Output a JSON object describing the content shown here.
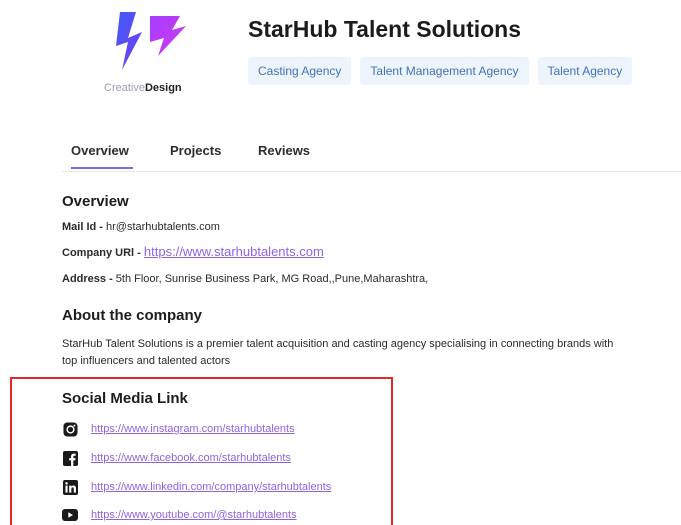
{
  "logo": {
    "text_light": "Creative",
    "text_bold": "Design",
    "accent_colors": [
      "#7a3cf5",
      "#c23bff",
      "#3d5cf5"
    ]
  },
  "company": {
    "name": "StarHub Talent Solutions",
    "tags": [
      "Casting Agency",
      "Talent Management Agency",
      "Talent Agency"
    ]
  },
  "tabs": [
    {
      "label": "Overview",
      "active": true
    },
    {
      "label": "Projects",
      "active": false
    },
    {
      "label": "Reviews",
      "active": false
    }
  ],
  "overview": {
    "heading": "Overview",
    "mail_label": "Mail Id - ",
    "mail_value": "hr@starhubtalents.com",
    "url_label": "Company URl - ",
    "url_value": "https://www.starhubtalents.com",
    "address_label": "Address - ",
    "address_value": "5th Floor, Sunrise Business Park, MG Road,,Pune,Maharashtra,"
  },
  "about": {
    "heading": "About the company",
    "text": "StarHub Talent Solutions is a premier talent acquisition and casting agency specialising in connecting brands with top influencers and talented actors"
  },
  "social": {
    "heading": "Social Media Link",
    "links": [
      {
        "icon": "instagram-icon",
        "url": "https://www.instagram.com/starhubtalents"
      },
      {
        "icon": "facebook-icon",
        "url": "https://www.facebook.com/starhubtalents"
      },
      {
        "icon": "linkedin-icon",
        "url": "https://www.linkedin.com/company/starhubtalents"
      },
      {
        "icon": "youtube-icon",
        "url": "https://www.youtube.com/@starhubtalents"
      }
    ]
  },
  "colors": {
    "link": "#8f63e0",
    "tab_active": "#7d6be0",
    "tag_bg": "#eef4fb",
    "tag_text": "#4173b8",
    "highlight": "#e02a2a"
  }
}
